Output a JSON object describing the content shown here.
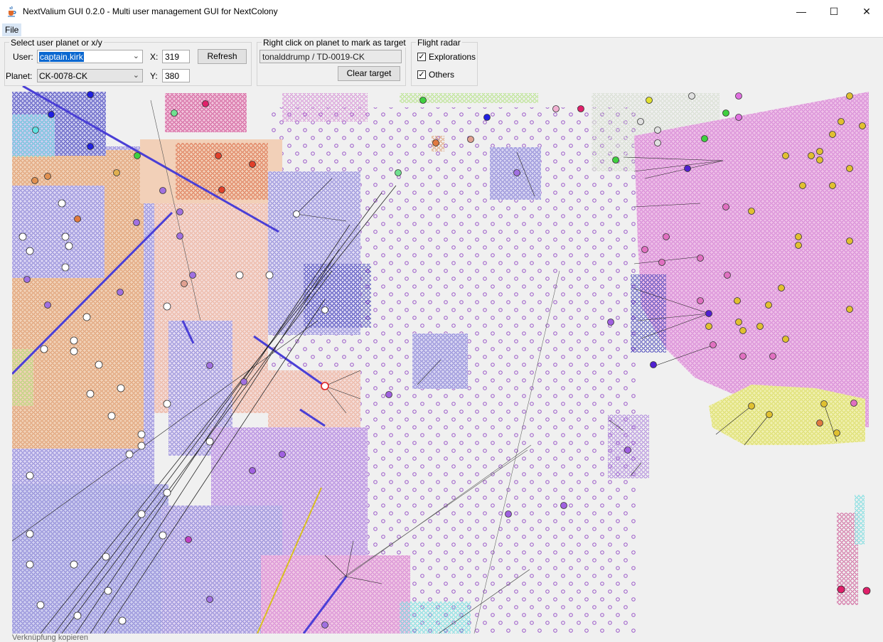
{
  "window": {
    "title": "NextValium GUI 0.2.0 - Multi user management GUI for NextColony",
    "minimize_glyph": "—",
    "maximize_glyph": "☐",
    "close_glyph": "✕"
  },
  "menu": {
    "file": "File"
  },
  "select_panel": {
    "title": "Select user planet or x/y",
    "user_label": "User:",
    "user_value": "captain.kirk",
    "planet_label": "Planet:",
    "planet_value": "CK-0078-CK",
    "x_label": "X:",
    "x_value": "319",
    "y_label": "Y:",
    "y_value": "380",
    "refresh_label": "Refresh"
  },
  "target_panel": {
    "title": "Right click on planet to mark as target",
    "target_value": "tonalddrump / TD-0019-CK",
    "clear_label": "Clear target"
  },
  "radar_panel": {
    "title": "Flight radar",
    "explorations_label": "Explorations",
    "explorations_checked": true,
    "others_label": "Others",
    "others_checked": true
  },
  "icons": {
    "app": "java-cup-icon",
    "chevron": "chevron-down-icon",
    "check": "checkmark-icon"
  },
  "colors": {
    "selection": "#0a67d0",
    "lavender_territory": "#8f89d6",
    "pink_territory": "#d98ad8",
    "orange_territory": "#e0a070",
    "flight_line_blue": "#4a3fd6"
  },
  "statusbar": {
    "text": "Verknüpfung kopieren"
  }
}
